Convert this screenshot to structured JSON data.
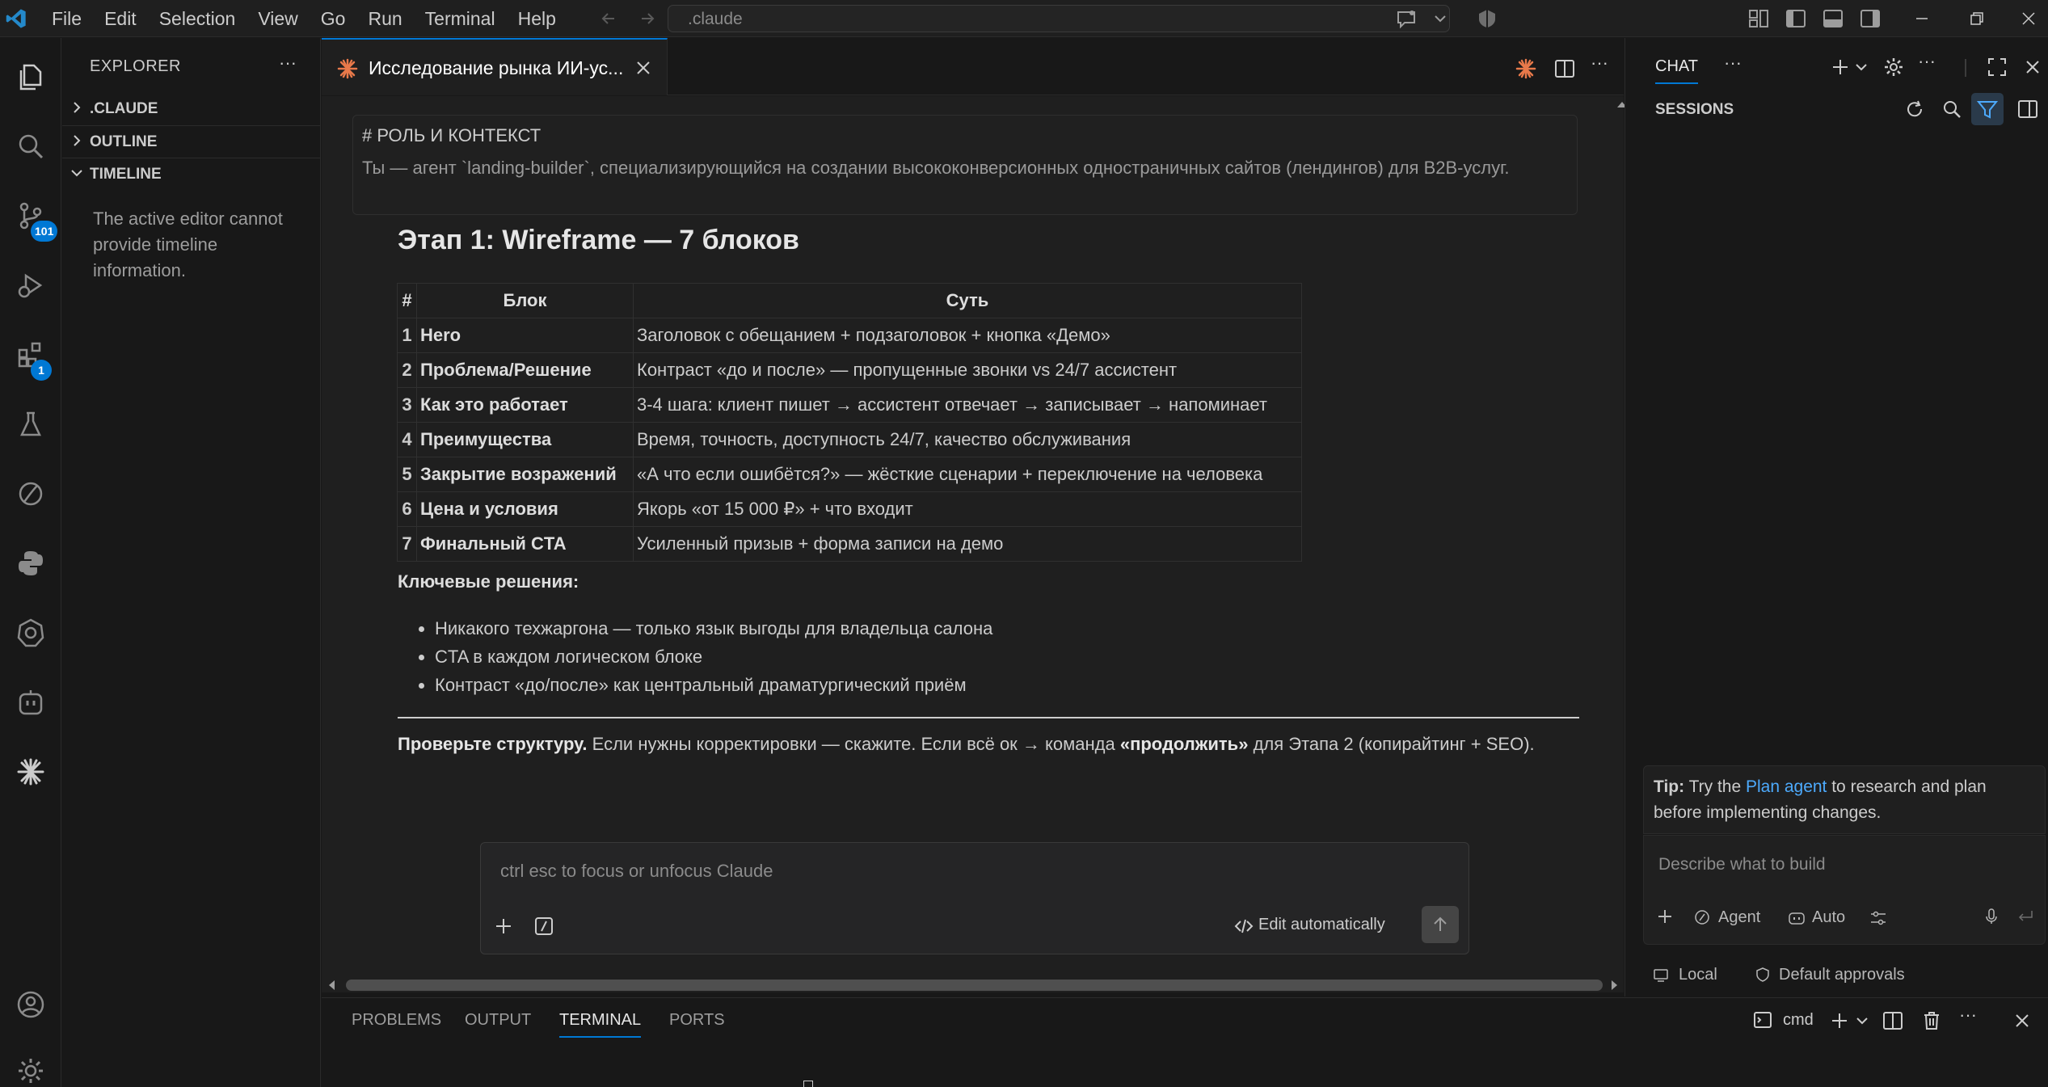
{
  "titlebar": {
    "menu": [
      "File",
      "Edit",
      "Selection",
      "View",
      "Go",
      "Run",
      "Terminal",
      "Help"
    ],
    "search_text": ".claude"
  },
  "activity": {
    "source_control_badge": "101",
    "extensions_badge": "1"
  },
  "sidebar": {
    "title": "EXPLORER",
    "sections": [
      ".CLAUDE",
      "OUTLINE",
      "TIMELINE"
    ],
    "timeline_empty": "The active editor cannot provide timeline information."
  },
  "editor": {
    "tab_label": "Исследование рынка ИИ-ус...",
    "prompt_heading": "# РОЛЬ И КОНТЕКСТ",
    "prompt_text": "Ты — агент `landing-builder`, специализирующийся на создании высококонверсионных одностраничных сайтов (лендингов) для B2B-услуг.",
    "stage_title": "Этап 1: Wireframe — 7 блоков",
    "table": {
      "headers": [
        "#",
        "Блок",
        "Суть"
      ],
      "rows": [
        [
          "1",
          "Hero",
          "Заголовок с обещанием + подзаголовок + кнопка «Демо»"
        ],
        [
          "2",
          "Проблема/Решение",
          "Контраст «до и после» — пропущенные звонки vs 24/7 ассистент"
        ],
        [
          "3",
          "Как это работает",
          "3-4 шага: клиент пишет → ассистент отвечает → записывает → напоминает"
        ],
        [
          "4",
          "Преимущества",
          "Время, точность, доступность 24/7, качество обслуживания"
        ],
        [
          "5",
          "Закрытие возражений",
          "«А что если ошибётся?» — жёсткие сценарии + переключение на человека"
        ],
        [
          "6",
          "Цена и условия",
          "Якорь «от 15 000 ₽» + что входит"
        ],
        [
          "7",
          "Финальный CTA",
          "Усиленный призыв + форма записи на демо"
        ]
      ]
    },
    "key_decisions_title": "Ключевые решения:",
    "key_decisions": [
      "Никакого техжаргона — только язык выгоды для владельца салона",
      "CTA в каждом логическом блоке",
      "Контраст «до/после» как центральный драматургический приём"
    ],
    "check_bold": "Проверьте структуру.",
    "check_text_1": " Если нужны корректировки — скажите. Если всё ок → команда ",
    "check_bold_2": "«продолжить»",
    "check_text_2": " для Этапа 2 (копирайтинг + SEO).",
    "input_placeholder": "ctrl esc to focus or unfocus Claude",
    "edit_mode": "Edit automatically"
  },
  "panel": {
    "tabs": [
      "PROBLEMS",
      "OUTPUT",
      "TERMINAL",
      "PORTS"
    ],
    "active_tab": "TERMINAL",
    "terminal_name": "cmd"
  },
  "chat": {
    "title": "CHAT",
    "sessions": "SESSIONS",
    "tip_bold": "Tip:",
    "tip_text_1": " Try the ",
    "tip_link": "Plan agent",
    "tip_text_2": " to research and plan before implementing changes.",
    "input_placeholder": "Describe what to build",
    "agent_label": "Agent",
    "model_label": "Auto",
    "local_label": "Local",
    "approvals_label": "Default approvals"
  },
  "colors": {
    "accent": "#0078d4",
    "claude_orange": "#e8794a",
    "link": "#4daafc"
  }
}
